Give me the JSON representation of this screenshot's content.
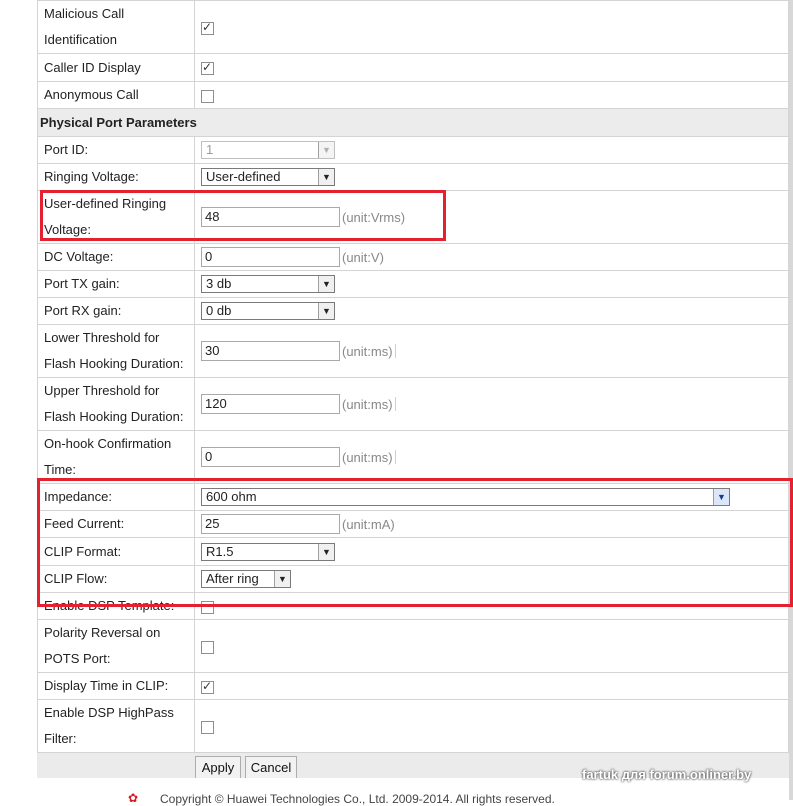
{
  "rows_top": [
    {
      "label": "Malicious Call Identification",
      "checked": true
    },
    {
      "label": "Caller ID Display",
      "checked": true
    },
    {
      "label": "Anonymous Call",
      "checked": false
    }
  ],
  "section_title": "Physical Port Parameters",
  "port_id": {
    "label": "Port ID:",
    "value": "1"
  },
  "ringing_voltage": {
    "label": "Ringing Voltage:",
    "value": "User-defined"
  },
  "user_ringing_voltage": {
    "label": "User-defined Ringing Voltage:",
    "value": "48",
    "unit": "(unit:Vrms)"
  },
  "dc_voltage": {
    "label": "DC Voltage:",
    "value": "0",
    "unit": "(unit:V)"
  },
  "port_tx_gain": {
    "label": "Port TX gain:",
    "value": "3 db"
  },
  "port_rx_gain": {
    "label": "Port RX gain:",
    "value": "0 db"
  },
  "lower_flash": {
    "label": "Lower Threshold for Flash Hooking Duration:",
    "value": "30",
    "unit": "(unit:ms)"
  },
  "upper_flash": {
    "label": "Upper Threshold for Flash Hooking Duration:",
    "value": "120",
    "unit": "(unit:ms)"
  },
  "onhook_confirm": {
    "label": "On-hook Confirmation Time:",
    "value": "0",
    "unit": "(unit:ms)"
  },
  "impedance": {
    "label": "Impedance:",
    "value": "600 ohm"
  },
  "feed_current": {
    "label": "Feed Current:",
    "value": "25",
    "unit": "(unit:mA)"
  },
  "clip_format": {
    "label": "CLIP Format:",
    "value": "R1.5"
  },
  "clip_flow": {
    "label": "CLIP Flow:",
    "value": "After ring"
  },
  "enable_dsp_template": {
    "label": "Enable DSP Template:",
    "checked": false
  },
  "polarity_reversal": {
    "label": "Polarity Reversal on POTS Port:",
    "checked": false
  },
  "display_time_clip": {
    "label": "Display Time in CLIP:",
    "checked": true
  },
  "dsp_highpass": {
    "label": "Enable DSP HighPass Filter:",
    "checked": false
  },
  "buttons": {
    "apply": "Apply",
    "cancel": "Cancel"
  },
  "footer": {
    "copyright": "Copyright © Huawei Technologies Co., Ltd. 2009-2014. All rights reserved."
  },
  "watermark": "fartuk для forum.onliner.by",
  "colors": {
    "highlight_red": "#e32131",
    "panel_gray": "#ebebeb"
  }
}
